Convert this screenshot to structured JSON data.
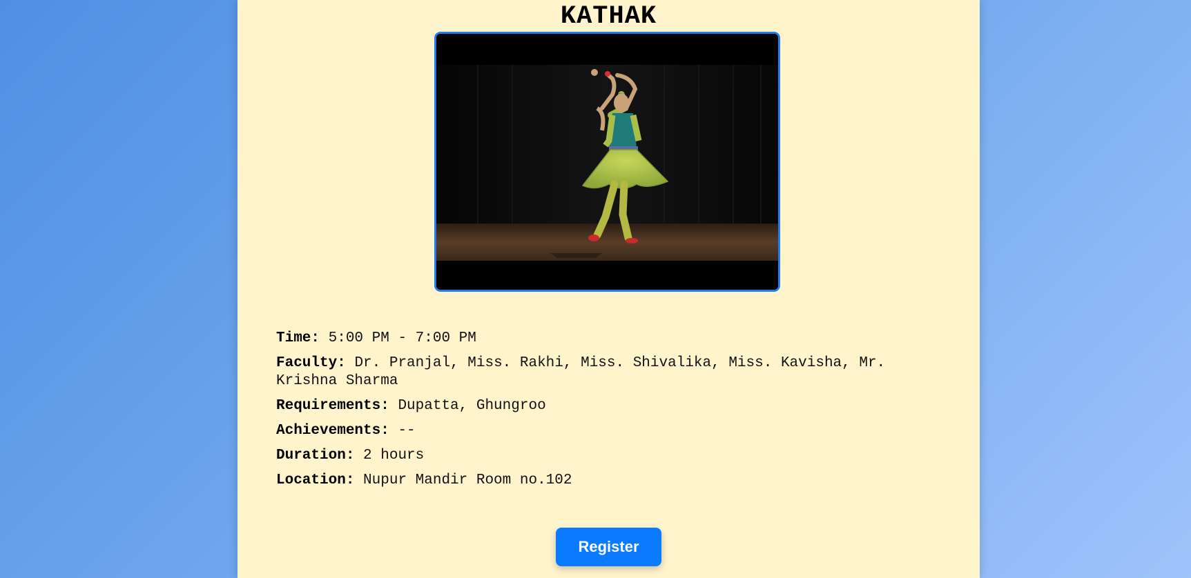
{
  "page": {
    "title": "KATHAK"
  },
  "image": {
    "alt": "Kathak dancer performing on stage",
    "border_color": "#1e7ef0"
  },
  "details": [
    {
      "label": "Time:",
      "value": "5:00 PM - 7:00 PM"
    },
    {
      "label": "Faculty:",
      "value": "Dr. Pranjal, Miss. Rakhi, Miss. Shivalika, Miss. Kavisha, Mr. Krishna Sharma"
    },
    {
      "label": "Requirements:",
      "value": "Dupatta, Ghungroo"
    },
    {
      "label": "Achievements:",
      "value": "--"
    },
    {
      "label": "Duration:",
      "value": "2 hours"
    },
    {
      "label": "Location:",
      "value": "Nupur Mandir Room no.102"
    }
  ],
  "actions": {
    "register_label": "Register"
  },
  "colors": {
    "panel_bg": "#fff4cc",
    "button_bg": "#0a7bff",
    "background_start": "#4f8fe3",
    "background_end": "#9fc3fb"
  }
}
